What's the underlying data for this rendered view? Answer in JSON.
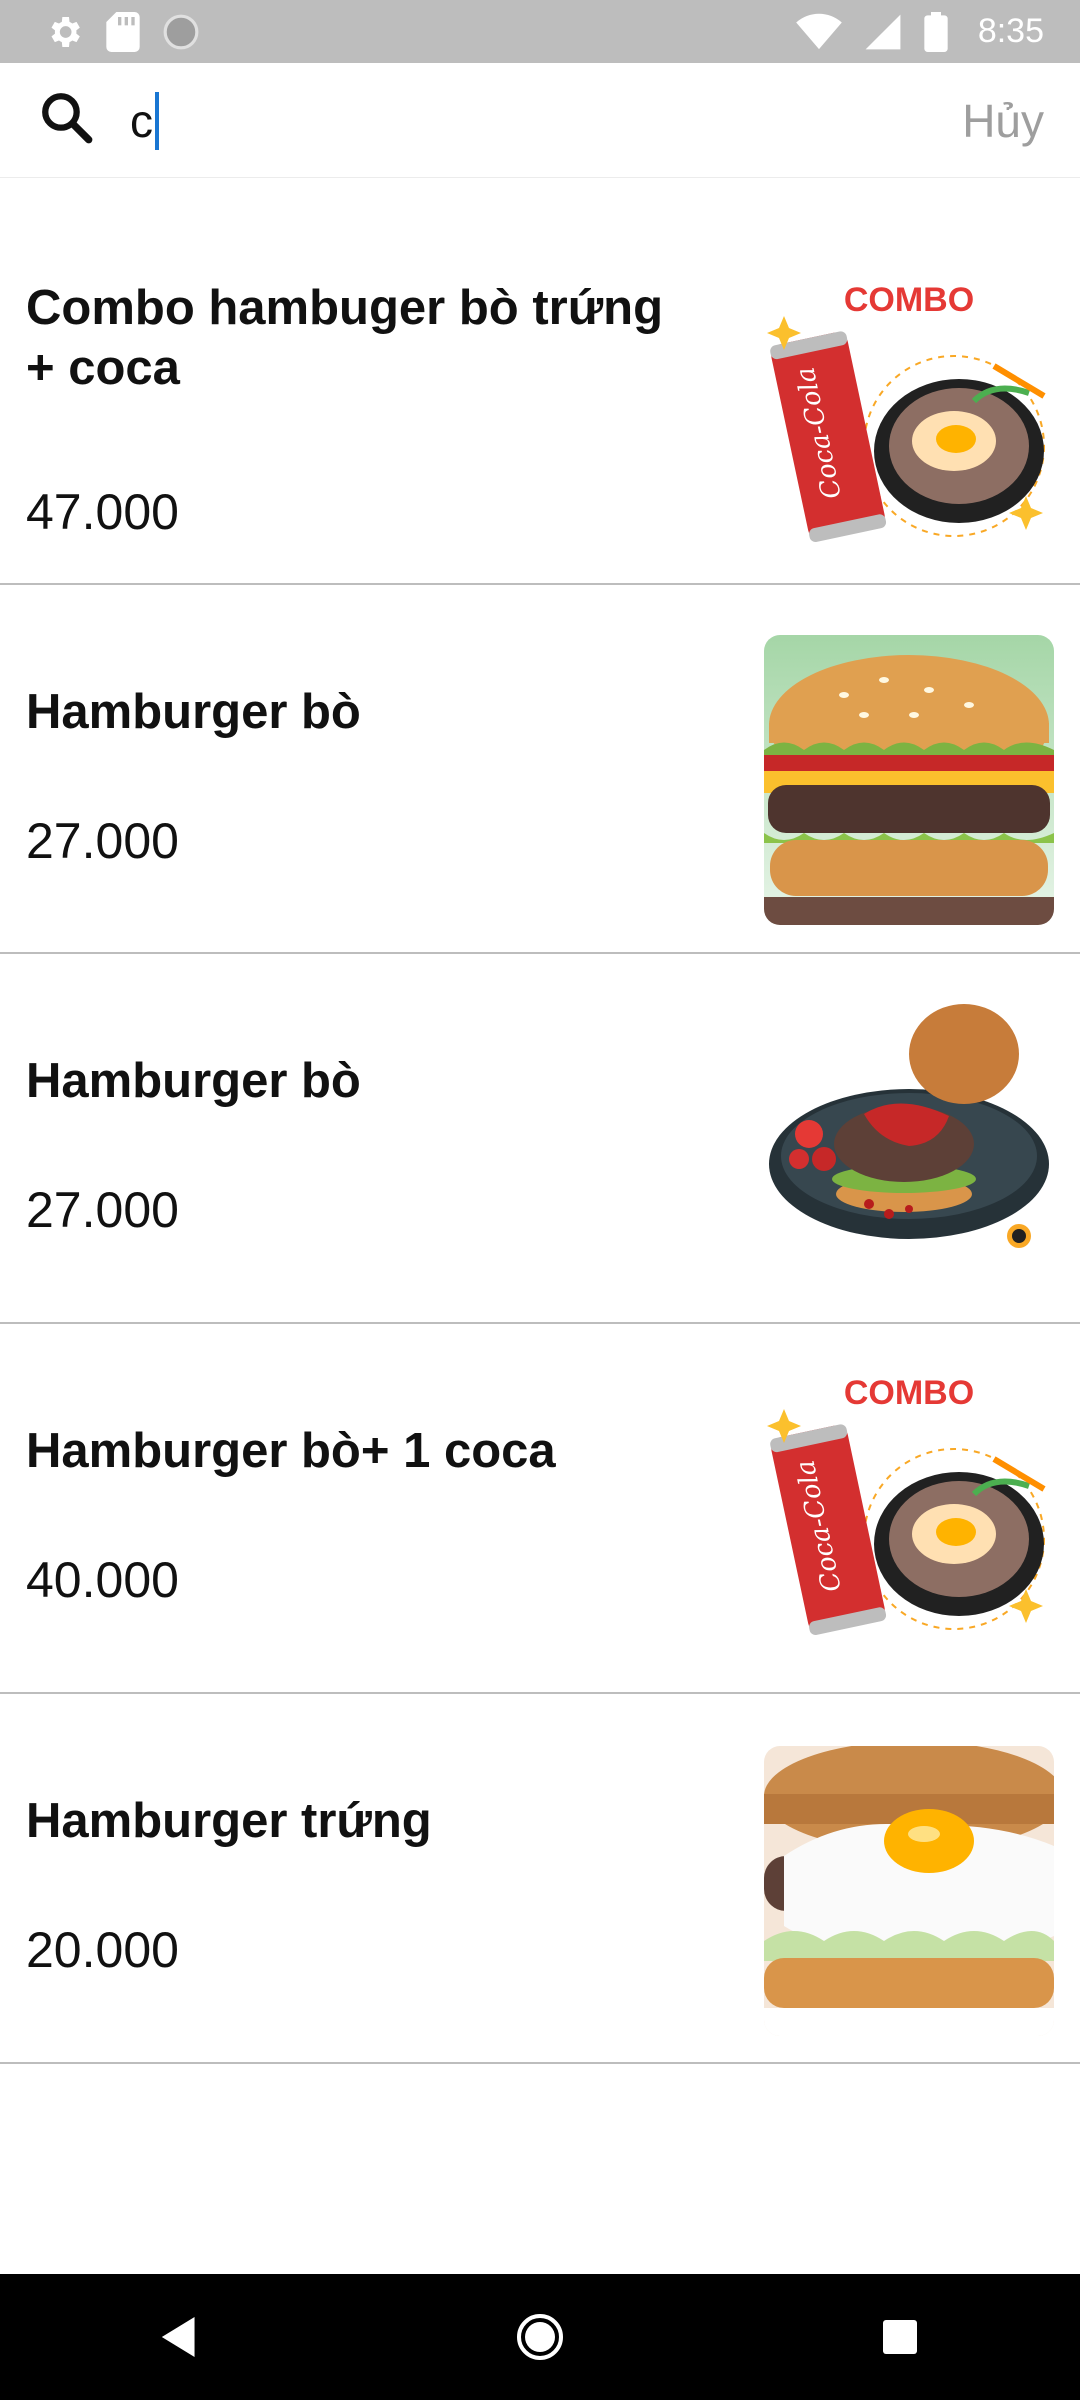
{
  "status_bar": {
    "time": "8:35",
    "icons": [
      "gear-icon",
      "sd-card-icon",
      "circle-icon",
      "wifi-icon",
      "signal-icon",
      "battery-icon"
    ]
  },
  "search": {
    "value": "c",
    "cancel_label": "Hủy",
    "accent_color": "#1976d2"
  },
  "results": [
    {
      "name": "Combo hambuger bò trứng + coca",
      "price": "47.000",
      "image": "combo-coca-icon"
    },
    {
      "name": "Hamburger bò",
      "price": "27.000",
      "image": "burger-photo"
    },
    {
      "name": "Hamburger bò",
      "price": "27.000",
      "image": "burger-plate-photo"
    },
    {
      "name": "Hamburger bò+ 1 coca",
      "price": "40.000",
      "image": "combo-coca-icon"
    },
    {
      "name": "Hamburger trứng",
      "price": "20.000",
      "image": "egg-burger-photo"
    }
  ],
  "combo_badge": "COMBO",
  "nav": [
    "back-icon",
    "home-icon",
    "recents-icon"
  ]
}
